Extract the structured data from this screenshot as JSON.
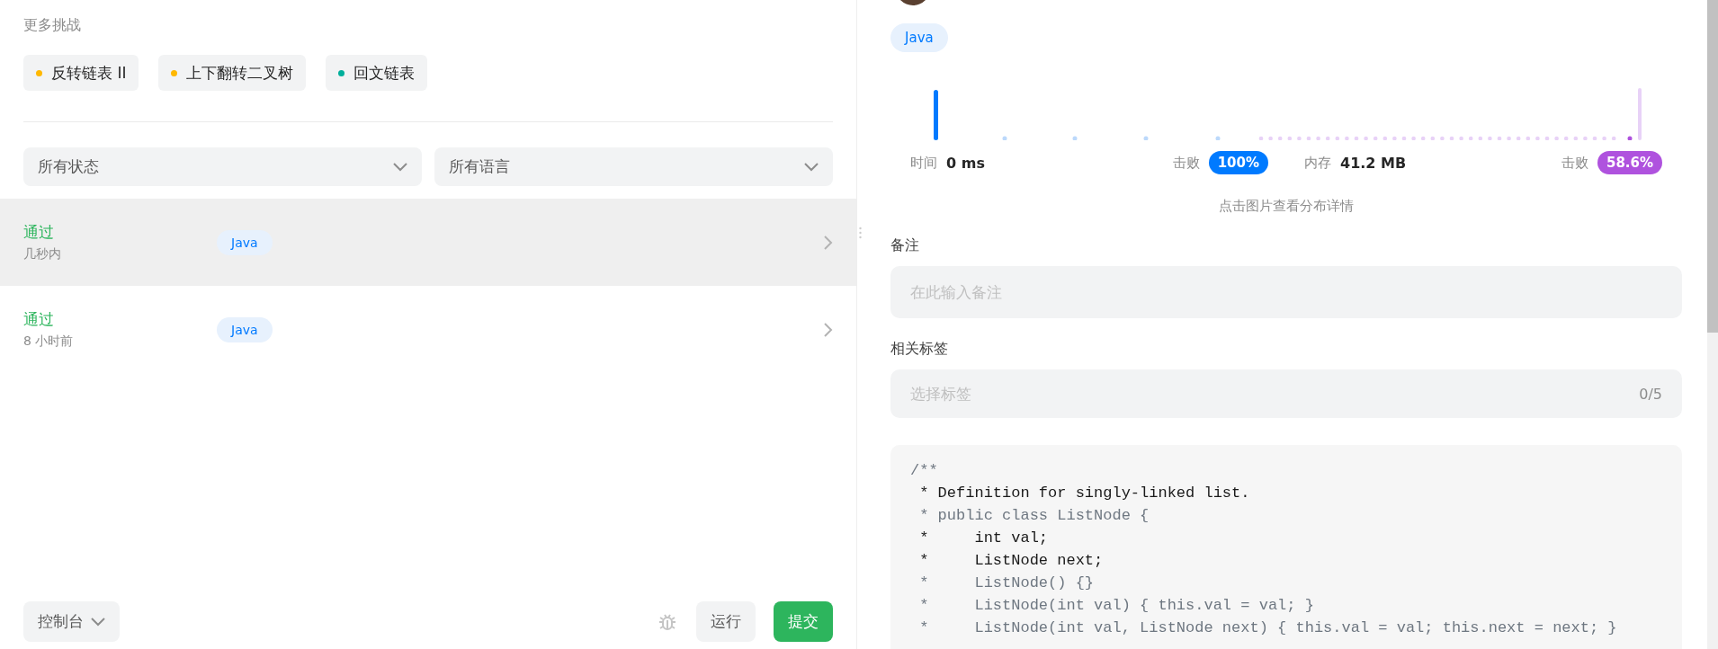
{
  "more_challenges": {
    "title": "更多挑战",
    "items": [
      {
        "label": "反转链表 II",
        "color": "#ffb800"
      },
      {
        "label": "上下翻转二叉树",
        "color": "#ffb800"
      },
      {
        "label": "回文链表",
        "color": "#00af9b"
      }
    ]
  },
  "filters": [
    {
      "label": "所有状态"
    },
    {
      "label": "所有语言"
    }
  ],
  "submissions": [
    {
      "status": "通过",
      "time": "几秒内",
      "language": "Java",
      "selected": true
    },
    {
      "status": "通过",
      "time": "8 小时前",
      "language": "Java",
      "selected": false
    }
  ],
  "footer": {
    "console": "控制台",
    "run": "运行",
    "submit": "提交"
  },
  "detail": {
    "language": "Java",
    "metrics": [
      {
        "kind": "runtime",
        "label": "时间",
        "value": "0 ms",
        "beats_label": "击败",
        "beats": "100%",
        "color": "#007aff"
      },
      {
        "kind": "memory",
        "label": "内存",
        "value": "41.2 MB",
        "beats_label": "击败",
        "beats": "58.6%",
        "color": "#af52de"
      }
    ],
    "chart_hint": "点击图片查看分布详情",
    "note": {
      "label": "备注",
      "placeholder": "在此输入备注"
    },
    "tags": {
      "label": "相关标签",
      "placeholder": "选择标签",
      "count": "0/5"
    },
    "code": [
      {
        "text": "/**",
        "emphasis": false
      },
      {
        "text": " * Definition for singly-linked list.",
        "emphasis": true
      },
      {
        "text": " * public class ListNode {",
        "emphasis": false
      },
      {
        "text": " *     int val;",
        "emphasis": true
      },
      {
        "text": " *     ListNode next;",
        "emphasis": true
      },
      {
        "text": " *     ListNode() {}",
        "emphasis": false
      },
      {
        "text": " *     ListNode(int val) { this.val = val; }",
        "emphasis": false
      },
      {
        "text": " *     ListNode(int val, ListNode next) { this.val = val; this.next = next; }",
        "emphasis": false
      }
    ]
  }
}
